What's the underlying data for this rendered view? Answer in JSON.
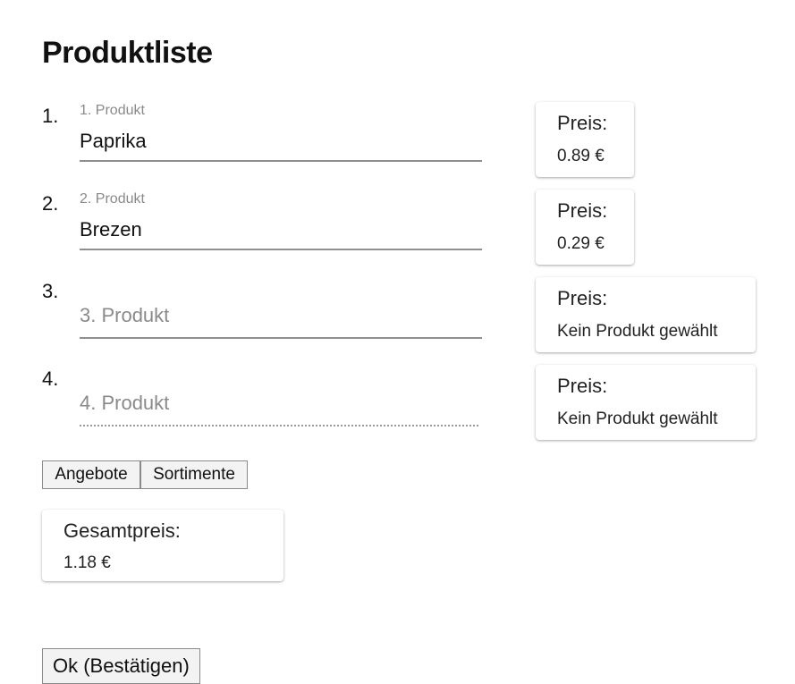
{
  "page": {
    "title": "Produktliste"
  },
  "products": [
    {
      "number": "1.",
      "label": "1. Produkt",
      "value": "Paprika",
      "placeholder": ""
    },
    {
      "number": "2.",
      "label": "2. Produkt",
      "value": "Brezen",
      "placeholder": ""
    },
    {
      "number": "3.",
      "label": "",
      "value": "",
      "placeholder": "3. Produkt"
    },
    {
      "number": "4.",
      "label": "",
      "value": "",
      "placeholder": "4. Produkt"
    }
  ],
  "prices": [
    {
      "title": "Preis:",
      "value": "0.89 €"
    },
    {
      "title": "Preis:",
      "value": "0.29 €"
    },
    {
      "title": "Preis:",
      "value": "Kein Produkt gewählt"
    },
    {
      "title": "Preis:",
      "value": "Kein Produkt gewählt"
    }
  ],
  "buttons": {
    "offers": "Angebote",
    "assortments": "Sortimente",
    "ok": "Ok (Bestätigen)"
  },
  "total": {
    "title": "Gesamtpreis:",
    "value": "1.18 €"
  }
}
